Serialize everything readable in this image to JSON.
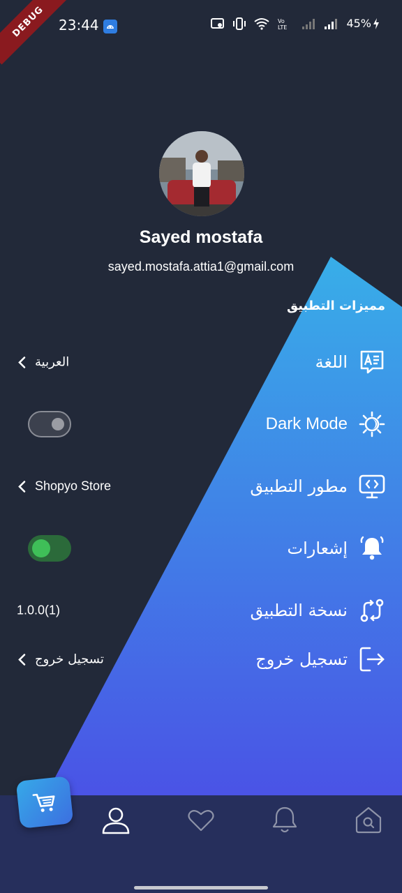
{
  "status_bar": {
    "time": "23:44",
    "battery": "45%",
    "debug_label": "DEBUG",
    "icons": [
      "android-icon",
      "cast-icon",
      "vibrate-icon",
      "wifi-icon",
      "volte-icon",
      "signal-icon",
      "signal-icon",
      "battery-charging-icon"
    ]
  },
  "profile": {
    "name": "Sayed mostafa",
    "email": "sayed.mostafa.attia1@gmail.com"
  },
  "section": {
    "title": "مميزات التطبيق"
  },
  "settings": [
    {
      "label": "اللغة",
      "value": "العربية",
      "icon": "translate-icon"
    },
    {
      "label": "Dark Mode",
      "toggle_on": false,
      "icon": "sun-moon-icon"
    },
    {
      "label": "مطور التطبيق",
      "value": "Shopyo Store",
      "icon": "monitor-code-icon"
    },
    {
      "label": "إشعارات",
      "toggle_on": true,
      "icon": "bell-icon"
    },
    {
      "label": "نسخة التطبيق",
      "value": "1.0.0(1)",
      "icon": "version-route-icon"
    },
    {
      "label": "تسجيل خروج",
      "value": "تسجيل خروج",
      "icon": "logout-icon"
    }
  ],
  "bottom_nav": {
    "items": [
      "cart-icon",
      "profile-icon",
      "heart-icon",
      "bell-icon",
      "home-search-icon"
    ],
    "active": "profile-icon"
  },
  "colors": {
    "background": "#222939",
    "gradient_top": "#38aee8",
    "gradient_bottom": "#4a52e6",
    "nav_bg": "#262f5c",
    "toggle_on": "#3fbf58"
  }
}
